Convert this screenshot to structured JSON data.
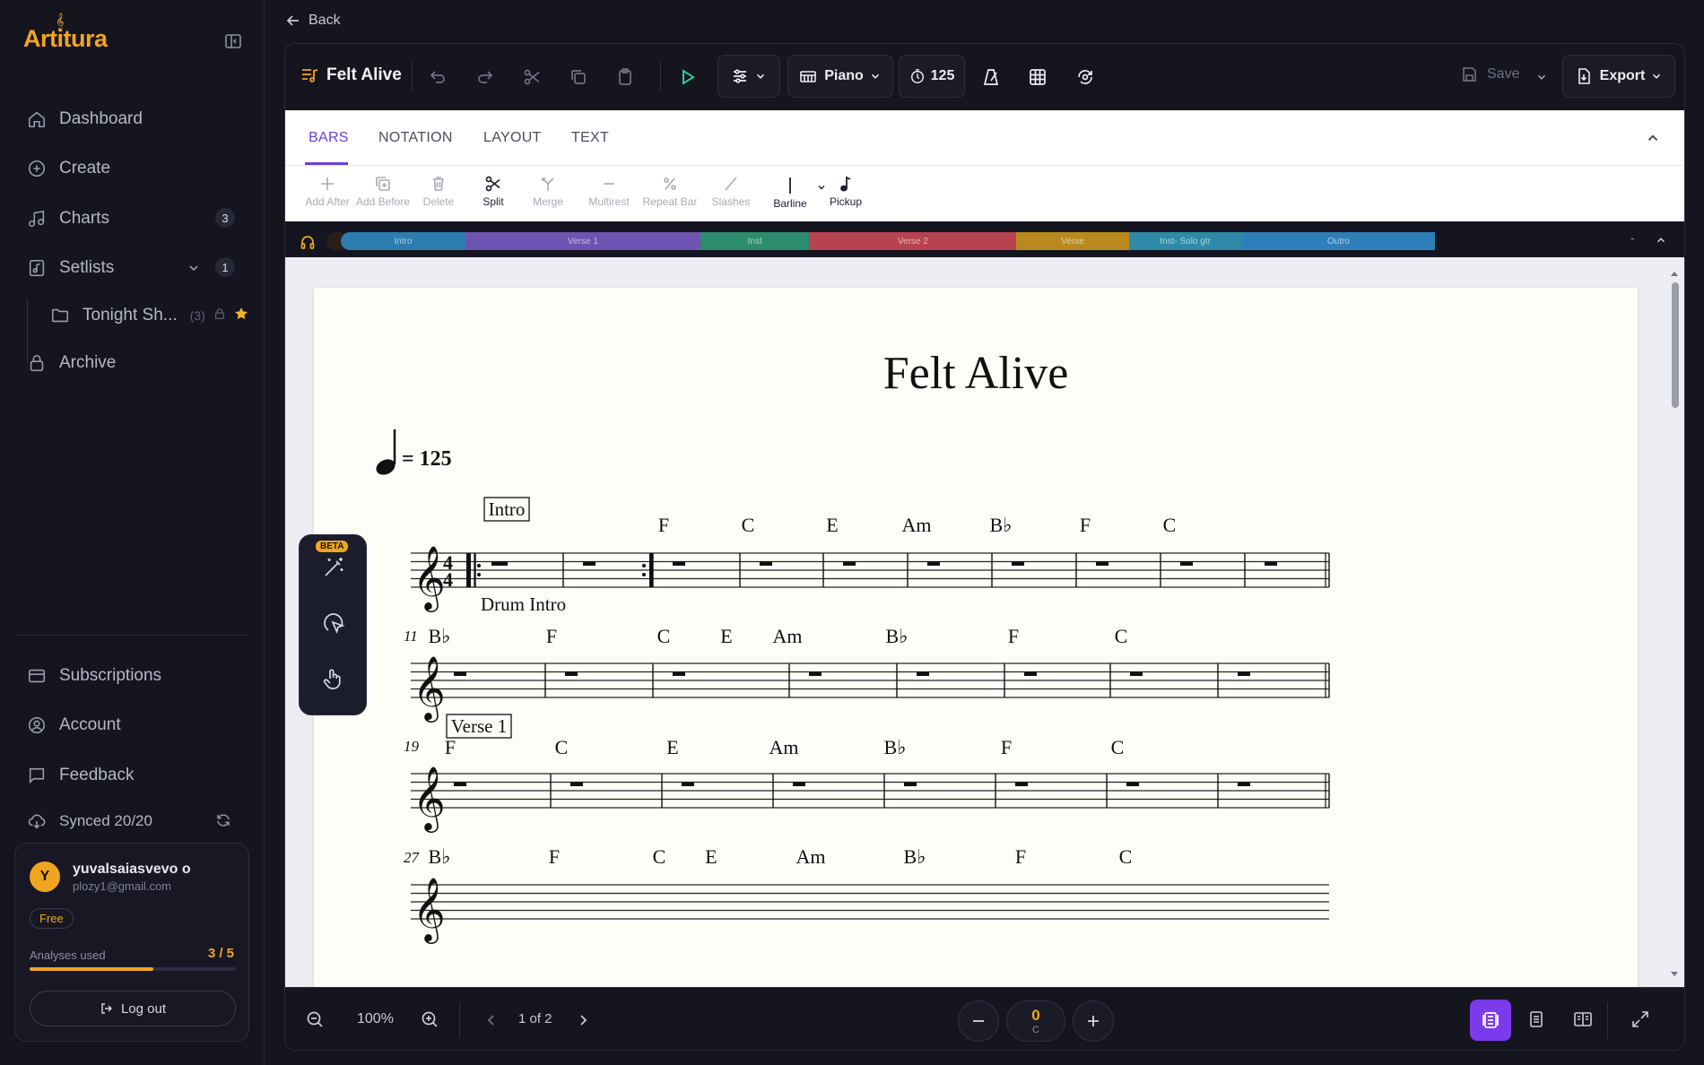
{
  "app": {
    "name_prefix": "Art",
    "name_suffix": "itura"
  },
  "sidebar": {
    "items": [
      {
        "label": "Dashboard"
      },
      {
        "label": "Create"
      },
      {
        "label": "Charts",
        "count": "3"
      },
      {
        "label": "Setlists",
        "count": "1"
      },
      {
        "label": "Tonight Sh...",
        "count": "(3)"
      },
      {
        "label": "Archive"
      }
    ],
    "bottom_items": [
      {
        "label": "Subscriptions"
      },
      {
        "label": "Account"
      },
      {
        "label": "Feedback"
      }
    ],
    "sync_status": "Synced 20/20",
    "user": {
      "initial": "Y",
      "name": "yuvalsaiasvevo o",
      "email": "plozy1@gmail.com",
      "plan": "Free",
      "analyses_label": "Analyses used",
      "analyses_count": "3 / 5",
      "analyses_fraction": 0.6,
      "logout": "Log out"
    }
  },
  "header": {
    "back_label": "Back"
  },
  "toolbar": {
    "title": "Felt Alive",
    "instrument": "Piano",
    "tempo": "125",
    "save_label": "Save",
    "export_label": "Export"
  },
  "tabs": [
    {
      "label": "BARS"
    },
    {
      "label": "NOTATION"
    },
    {
      "label": "LAYOUT"
    },
    {
      "label": "TEXT"
    }
  ],
  "tools": [
    {
      "label": "Add After",
      "icon": "plus-icon"
    },
    {
      "label": "Add Before",
      "icon": "copy-plus-icon"
    },
    {
      "label": "Delete",
      "icon": "trash-icon"
    },
    {
      "label": "Split",
      "icon": "scissors-icon"
    },
    {
      "label": "Merge",
      "icon": "merge-icon"
    },
    {
      "label": "Multirest",
      "icon": "minus-icon"
    },
    {
      "label": "Repeat Bar",
      "icon": "percent-icon"
    },
    {
      "label": "Slashes",
      "icon": "slash-icon"
    },
    {
      "label": "Barline",
      "icon": "barline-icon"
    },
    {
      "label": "Pickup",
      "icon": "note-icon"
    }
  ],
  "timeline": {
    "sections": [
      {
        "label": "Intro",
        "color": "#2c7cb0",
        "share": 10.3
      },
      {
        "label": "Verse 1",
        "color": "#6d54b0",
        "share": 19.4
      },
      {
        "label": "Inst",
        "color": "#2e8c6e",
        "share": 9.0
      },
      {
        "label": "Verse 2",
        "color": "#b8424f",
        "share": 17.1
      },
      {
        "label": "Verse",
        "color": "#b88a1e",
        "share": 9.3
      },
      {
        "label": "Inst- Solo gtr",
        "color": "#2e8aa6",
        "share": 9.3
      },
      {
        "label": "Outro",
        "color": "#2e7fb8",
        "share": 16.0
      }
    ]
  },
  "score": {
    "title": "Felt Alive",
    "tempo_text": "= 125",
    "rows": [
      {
        "chords": [
          "F",
          "C",
          "E",
          "Am",
          "B♭",
          "F",
          "C"
        ],
        "rehearsal": "Intro",
        "text_below": "Drum Intro"
      },
      {
        "bar_number": "11",
        "chords": [
          "B♭",
          "F",
          "C",
          "E",
          "Am",
          "B♭",
          "F",
          "C"
        ]
      },
      {
        "bar_number": "19",
        "rehearsal": "Verse 1",
        "chords": [
          "F",
          "C",
          "E",
          "Am",
          "B♭",
          "F",
          "C"
        ]
      },
      {
        "bar_number": "27",
        "chords": [
          "B♭",
          "F",
          "C",
          "E",
          "Am",
          "B♭",
          "F",
          "C"
        ]
      }
    ]
  },
  "floating_tools": {
    "beta_label": "BETA"
  },
  "bottom": {
    "zoom": "100%",
    "page_indicator": "1 of 2",
    "transpose_value": "0",
    "transpose_key": "C"
  }
}
